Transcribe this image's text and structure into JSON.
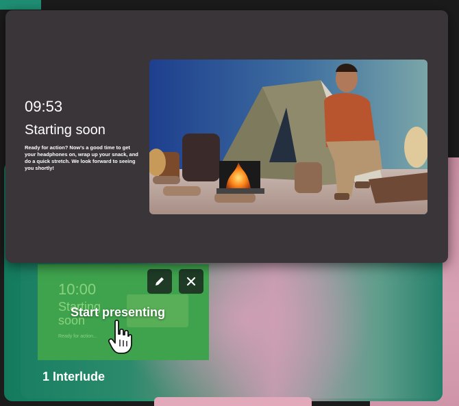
{
  "preview": {
    "time": "09:53",
    "title": "Starting soon",
    "description": "Ready for action? Now's a good time to get your headphones on, wrap up your snack, and do a quick stretch. We look forward to seeing you shortly!"
  },
  "thumbnail": {
    "time": "10:00",
    "title": "Starting soon",
    "description": "Ready for action...",
    "hover_label": "Start presenting",
    "edit_icon": "pencil-icon",
    "close_icon": "close-icon"
  },
  "card": {
    "label": "1 Interlude"
  },
  "colors": {
    "preview_bg": "#3a3538",
    "thumbnail_bg": "#3fa34d",
    "thumbnail_text": "#8ad37e",
    "icon_button_bg": "#1f3b26"
  }
}
